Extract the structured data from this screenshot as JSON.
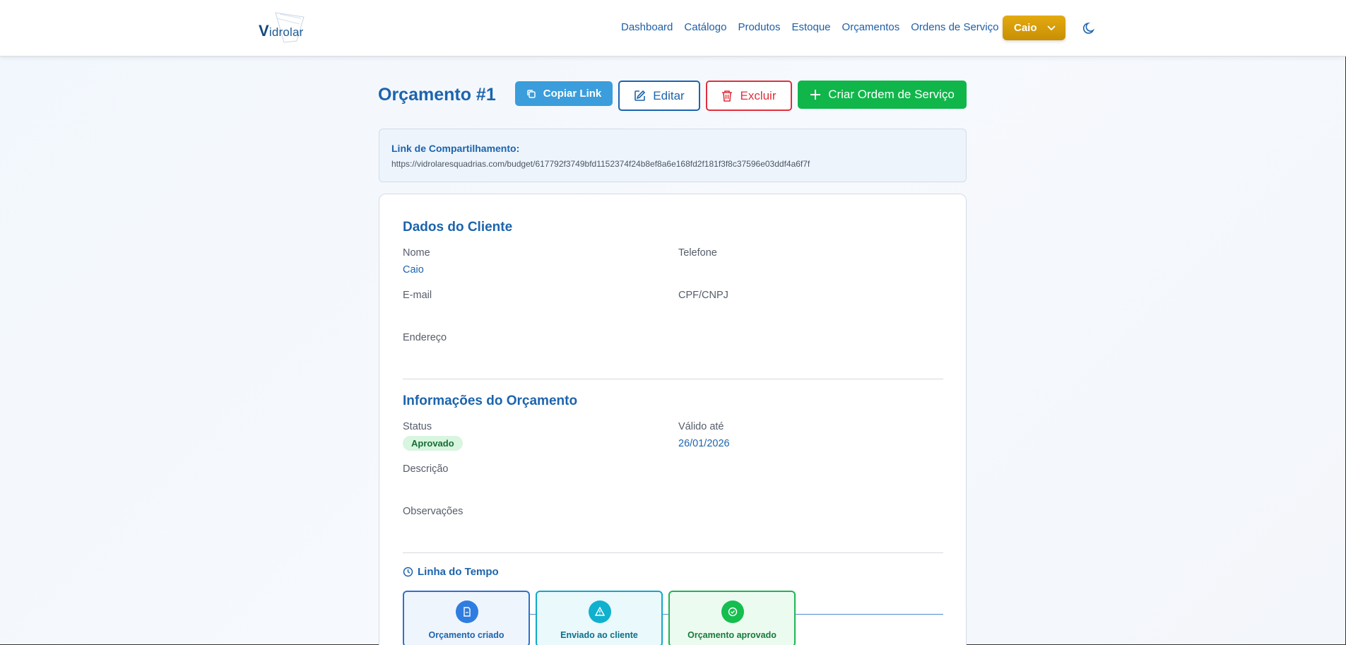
{
  "brand": {
    "name_v": "V",
    "name_rest": "idrolar"
  },
  "nav": {
    "links": [
      "Dashboard",
      "Catálogo",
      "Produtos",
      "Estoque",
      "Orçamentos",
      "Ordens de Serviço"
    ],
    "user": "Caio"
  },
  "header": {
    "title": "Orçamento #1",
    "copy_link": "Copiar Link",
    "edit": "Editar",
    "delete": "Excluir",
    "create_os": "Criar Ordem de Serviço"
  },
  "share": {
    "label": "Link de Compartilhamento:",
    "url": "https://vidrolaresquadrias.com/budget/617792f3749bfd1152374f24b8ef8a6e168fd2f181f3f8c37596e03ddf4a6f7f"
  },
  "client": {
    "title": "Dados do Cliente",
    "name_label": "Nome",
    "name_value": "Caio",
    "phone_label": "Telefone",
    "email_label": "E-mail",
    "doc_label": "CPF/CNPJ",
    "address_label": "Endereço"
  },
  "budget_info": {
    "title": "Informações do Orçamento",
    "status_label": "Status",
    "status_value": "Aprovado",
    "valid_label": "Válido até",
    "valid_value": "26/01/2026",
    "description_label": "Descrição",
    "notes_label": "Observações"
  },
  "timeline": {
    "title": "Linha do Tempo",
    "steps": [
      "Orçamento criado",
      "Enviado ao cliente",
      "Orçamento aprovado"
    ]
  },
  "colors": {
    "primary": "#1c64ad",
    "copy": "#3b9ddb",
    "danger": "#e0303c",
    "success": "#10b64a",
    "user_button": "#d99e0a"
  }
}
